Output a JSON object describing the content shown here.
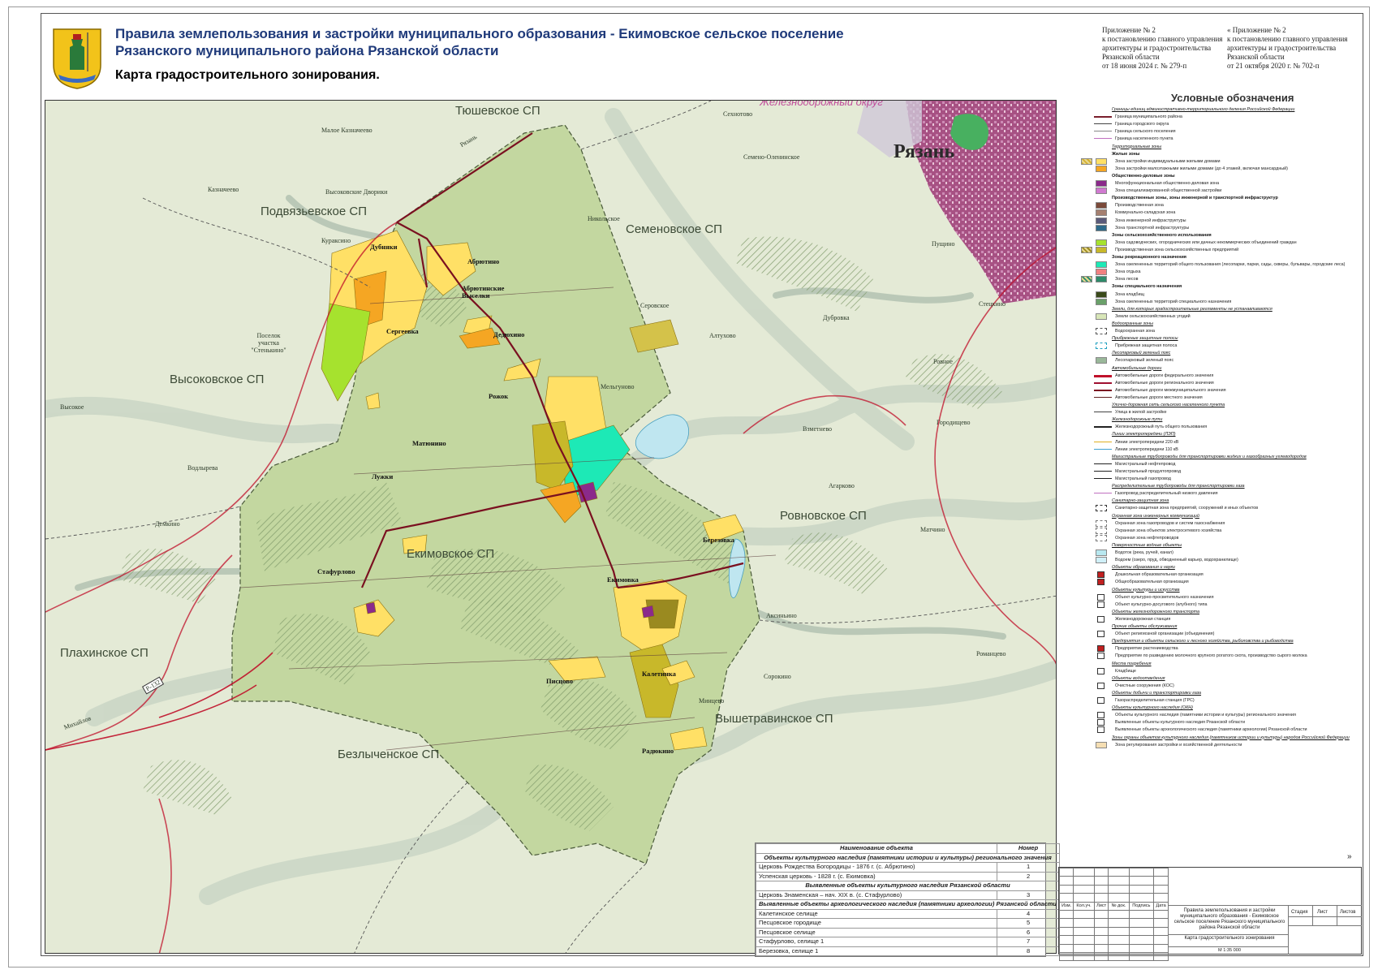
{
  "header": {
    "title_line1": "Правила землепользования и застройки муниципального образования - Екимовское сельское поселение",
    "title_line2": "Рязанского муниципального района Рязанской области",
    "subtitle": "Карта градостроительного зонирования.",
    "appendix_left": [
      "Приложение № 2",
      "к постановлению главного управления",
      "архитектуры и градостроительства",
      "Рязанской области",
      "от 18 июня 2024 г. № 279-п"
    ],
    "appendix_right": [
      "« Приложение № 2",
      "к постановлению главного управления",
      "архитектуры и градостроительства",
      "Рязанской области",
      "от 21 октября 2020 г. № 702-п"
    ]
  },
  "map": {
    "settlements_areas": [
      "Тюшевское СП",
      "Подвязьевское СП",
      "Семеновское СП",
      "Высоковское СП",
      "Ровновское СП",
      "Екимовское СП",
      "Плахинское СП",
      "Вышетравинское СП",
      "Безлыченское СП"
    ],
    "city": "Рязань",
    "district": "Железнодорожный округ",
    "villages_main": [
      "Дубняки",
      "Абрютино",
      "Абрютинские Выселки",
      "Сергеевка",
      "Дедюхино",
      "Рожок",
      "Матюнино",
      "Лужки",
      "Стафурлово",
      "Екимовка",
      "Березовка",
      "Писцово",
      "Калетинка",
      "Радюкино"
    ],
    "villages_other": [
      "Малое Казначеево",
      "Высоковские Дворики",
      "Казначеево",
      "Кураксино",
      "Поселок участка \"Стенькино\"",
      "Высокое",
      "Водлырева",
      "Демкино",
      "Сехнотово",
      "Семено-Оленинское",
      "Никольское",
      "Серовское",
      "Алтухово",
      "Дубровка",
      "Пущино",
      "Стецкино",
      "Ровное",
      "Мельгуново",
      "Взметнево",
      "Городищево",
      "Агарково",
      "Матчино",
      "Аксиньино",
      "Романцево",
      "Сорокино",
      "Минцево",
      "Михайлов",
      "Рязань",
      "Р-132"
    ]
  },
  "objects_table": {
    "head_name": "Наименование объекта",
    "head_num": "Номер",
    "sections": [
      {
        "title": "Объекты культурного наследия (памятники истории и культуры) регионального значения",
        "rows": [
          [
            "Церковь Рождества Богородицы - 1876 г. (с. Абрютино)",
            "1"
          ],
          [
            "Успенская церковь - 1828 г. (с. Екимовка)",
            "2"
          ]
        ]
      },
      {
        "title": "Выявленные объекты культурного наследия Рязанской области",
        "rows": [
          [
            "Церковь Знаменская – нач. XIX в. (с. Стафурлово)",
            "3"
          ]
        ]
      },
      {
        "title": "Выявленные объекты археологического наследия (памятники археологии) Рязанской области",
        "rows": [
          [
            "Калетинское селище",
            "4"
          ],
          [
            "Песцовское городище",
            "5"
          ],
          [
            "Песцовское селище",
            "6"
          ],
          [
            "Стафурлово, селище 1",
            "7"
          ],
          [
            "Березовка, селище 1",
            "8"
          ]
        ]
      }
    ]
  },
  "legend": {
    "title": "Условные обозначения",
    "items": [
      {
        "k": "cat",
        "t": "Границы единиц административно-территориального деления Российской Федерации"
      },
      {
        "k": "line",
        "c": "#7a1e2c",
        "w": 2,
        "t": "Граница муниципального района"
      },
      {
        "k": "line",
        "c": "#444",
        "w": 1,
        "t": "Граница городского округа"
      },
      {
        "k": "line",
        "c": "#888",
        "w": 1,
        "t": "Граница сельского поселения"
      },
      {
        "k": "line",
        "c": "#c070c0",
        "w": 1,
        "t": "Граница населенного пункта"
      },
      {
        "k": "cat",
        "t": "Территориальные зоны"
      },
      {
        "k": "head",
        "t": "Жилые зоны"
      },
      {
        "k": "sw",
        "c": "#ffe066",
        "c2": "#d4b030",
        "t": "Зона застройки индивидуальными жилыми домами"
      },
      {
        "k": "sw",
        "c": "#f5a623",
        "t": "Зона застройки малоэтажными жилыми домами (до 4 этажей, включая мансардный)"
      },
      {
        "k": "head",
        "t": "Общественно-деловые зоны"
      },
      {
        "k": "sw",
        "c": "#8b2a8b",
        "t": "Многофункциональная общественно-деловая зона"
      },
      {
        "k": "sw",
        "c": "#d07ad0",
        "t": "Зона специализированной общественной застройки"
      },
      {
        "k": "head",
        "t": "Производственные зоны, зоны инженерной и транспортной инфраструктур"
      },
      {
        "k": "sw",
        "c": "#7b4a3a",
        "t": "Производственная зона"
      },
      {
        "k": "sw",
        "c": "#a58070",
        "t": "Коммунально-складская зона"
      },
      {
        "k": "sw",
        "c": "#5a5a7a",
        "t": "Зона инженерной инфраструктуры"
      },
      {
        "k": "sw",
        "c": "#2e6a8a",
        "t": "Зона транспортной инфраструктуры"
      },
      {
        "k": "head",
        "t": "Зоны сельскохозяйственного использования"
      },
      {
        "k": "sw",
        "c": "#a6e22e",
        "t": "Зона садоводческих, огороднических или дачных некоммерческих объединений граждан"
      },
      {
        "k": "sw",
        "c": "#c8b82a",
        "c2": "#9a8a20",
        "t": "Производственная зона сельскохозяйственных предприятий"
      },
      {
        "k": "head",
        "t": "Зоны рекреационного назначения"
      },
      {
        "k": "sw",
        "c": "#1de9b6",
        "t": "Зона озелененных территорий общего пользования (лесопарки, парки, сады, скверы, бульвары, городские леса)"
      },
      {
        "k": "sw",
        "c": "#f08080",
        "t": "Зона отдыха"
      },
      {
        "k": "sw",
        "c": "#2e8b6a",
        "c2": "#2e8b6a",
        "t": "Зона лесов"
      },
      {
        "k": "head",
        "t": "Зоны специального назначения"
      },
      {
        "k": "sw",
        "c": "#3a4a1a",
        "t": "Зона кладбищ"
      },
      {
        "k": "sw",
        "c": "#6aa06a",
        "t": "Зона озелененных территорий специального назначения"
      },
      {
        "k": "cat",
        "t": "Земли, для которых градостроительные регламенты не устанавливаются"
      },
      {
        "k": "sw",
        "c": "#d8e6b8",
        "t": "Земли сельскохозяйственных угодий"
      },
      {
        "k": "cat",
        "t": "Водоохранные зоны"
      },
      {
        "k": "swb",
        "c": "#555",
        "t": "Водоохранная зона"
      },
      {
        "k": "cat",
        "t": "Прибрежные защитные полосы"
      },
      {
        "k": "swb",
        "c": "#20a0c0",
        "t": "Прибрежная защитная полоса"
      },
      {
        "k": "cat",
        "t": "Лесопарковый зеленый пояс"
      },
      {
        "k": "sw",
        "c": "#9ab89a",
        "t": "Лесопарковый зеленый пояс"
      },
      {
        "k": "cat",
        "t": "Автомобильные дороги"
      },
      {
        "k": "line",
        "c": "#c0102a",
        "w": 3,
        "t": "Автомобильные дороги федерального значения"
      },
      {
        "k": "line",
        "c": "#a01030",
        "w": 2.5,
        "t": "Автомобильные дороги регионального значения"
      },
      {
        "k": "line",
        "c": "#7a1020",
        "w": 2,
        "t": "Автомобильные дороги межмуниципального значения"
      },
      {
        "k": "line",
        "c": "#602020",
        "w": 1,
        "t": "Автомобильные дороги местного значения"
      },
      {
        "k": "cat",
        "t": "Улично-дорожная сеть сельского населенного пункта"
      },
      {
        "k": "line",
        "c": "#444",
        "w": 1,
        "t": "Улица в жилой застройке"
      },
      {
        "k": "cat",
        "t": "Железнодорожные пути"
      },
      {
        "k": "line",
        "c": "#222",
        "w": 2,
        "t": "Железнодорожный путь общего пользования"
      },
      {
        "k": "cat",
        "t": "Линии электропередачи (ЛЭП)"
      },
      {
        "k": "line",
        "c": "#e0b020",
        "w": 1,
        "t": "Линии электропередачи 220 кВ"
      },
      {
        "k": "line",
        "c": "#40a0d0",
        "w": 1,
        "t": "Линии электропередачи 110 кВ"
      },
      {
        "k": "cat",
        "t": "Магистральные трубопроводы для транспортировки жидких и газообразных углеводородов"
      },
      {
        "k": "line",
        "c": "#222",
        "w": 1.5,
        "t": "Магистральный нефтепровод"
      },
      {
        "k": "line",
        "c": "#222",
        "w": 1.5,
        "t": "Магистральный продуктопровод"
      },
      {
        "k": "line",
        "c": "#222",
        "w": 1.5,
        "t": "Магистральный газопровод"
      },
      {
        "k": "cat",
        "t": "Распределительные трубопроводы для транспортировки газа"
      },
      {
        "k": "line",
        "c": "#c070c0",
        "w": 1.5,
        "t": "Газопровод распределительный низкого давления"
      },
      {
        "k": "cat",
        "t": "Санитарно-защитная зона"
      },
      {
        "k": "swb",
        "c": "#333",
        "t": "Санитарно-защитная зона предприятий, сооружений и иных объектов"
      },
      {
        "k": "cat",
        "t": "Охранная зона инженерных коммуникаций"
      },
      {
        "k": "swb",
        "c": "#777",
        "t": "Охранная зона газопроводов и систем газоснабжения"
      },
      {
        "k": "swb",
        "c": "#777",
        "t": "Охранная зона объектов электросетевого хозяйства"
      },
      {
        "k": "swb",
        "c": "#777",
        "t": "Охранная зона нефтепроводов"
      },
      {
        "k": "cat",
        "t": "Поверхностные водные объекты"
      },
      {
        "k": "sw",
        "c": "#b8e8f0",
        "t": "Водоток (река, ручей, канал)"
      },
      {
        "k": "sw",
        "c": "#d0f0f8",
        "t": "Водоем (озеро, пруд, обводненный карьер, водохранилище)"
      },
      {
        "k": "cat",
        "t": "Объекты образования и науки"
      },
      {
        "k": "ico",
        "c": "#c02020",
        "t": "Дошкольная образовательная организация"
      },
      {
        "k": "ico",
        "c": "#c02020",
        "t": "Общеобразовательная организация"
      },
      {
        "k": "cat",
        "t": "Объекты культуры и искусства"
      },
      {
        "k": "ico",
        "c": "#fff",
        "t": "Объект культурно-просветительного назначения"
      },
      {
        "k": "ico",
        "c": "#fff",
        "t": "Объект культурно-досугового (клубного) типа"
      },
      {
        "k": "cat",
        "t": "Объекты железнодорожного транспорта"
      },
      {
        "k": "ico",
        "c": "#fff",
        "t": "Железнодорожная станция"
      },
      {
        "k": "cat",
        "t": "Прочие объекты обслуживания"
      },
      {
        "k": "ico",
        "c": "#fff",
        "t": "Объект религиозной организации (объединения)"
      },
      {
        "k": "cat",
        "t": "Предприятия и объекты сельского и лесного хозяйства, рыболовства и рыбоводства"
      },
      {
        "k": "ico",
        "c": "#c02020",
        "t": "Предприятие растениеводства"
      },
      {
        "k": "ico",
        "c": "#fff",
        "t": "Предприятие по разведению молочного крупного рогатого скота, производство сырого молока"
      },
      {
        "k": "cat",
        "t": "Места погребения"
      },
      {
        "k": "ico",
        "c": "#fff",
        "t": "Кладбище"
      },
      {
        "k": "cat",
        "t": "Объекты водоотведения"
      },
      {
        "k": "ico",
        "c": "#fff",
        "t": "Очистные сооружения (КОС)"
      },
      {
        "k": "cat",
        "t": "Объекты добычи и транспортировки газа"
      },
      {
        "k": "ico",
        "c": "#fff",
        "t": "Газораспределительная станция (ГРС)"
      },
      {
        "k": "cat",
        "t": "Объекты культурного наследия (ОКН)"
      },
      {
        "k": "ico",
        "c": "#fff",
        "t": "Объекты культурного наследия (памятники истории и культуры) регионального значения"
      },
      {
        "k": "ico",
        "c": "#fff",
        "t": "Выявленные объекты культурного наследия Рязанской области"
      },
      {
        "k": "ico",
        "c": "#fff",
        "t": "Выявленные объекты археологического наследия (памятники археологии) Рязанской области"
      },
      {
        "k": "cat",
        "t": "Зоны охраны объектов культурного наследия (памятников истории и культуры) народов Российской Федерации"
      },
      {
        "k": "sw",
        "c": "#f5deb3",
        "t": "Зона регулирования застройки и хозяйственной деятельности"
      }
    ]
  },
  "stamp": {
    "cols": [
      "Изм.",
      "Кол.уч.",
      "Лист",
      "№ док.",
      "Подпись",
      "Дата"
    ],
    "project_title": "Правила землепользования и застройки муниципального образования - Екимовское сельское поселение Рязанского муниципального района Рязанской области",
    "sheet_title": "Карта градостроительного зонирования",
    "scale": "М 1:35 000",
    "stage": "Стадия",
    "sheet": "Лист",
    "sheets": "Листов"
  },
  "colors": {
    "title_blue": "#1f3a7a",
    "agri": "#dbe6bf",
    "forest": "#b9cf98",
    "settlement_yellow": "#ffe066",
    "border_red": "#c0102a"
  }
}
